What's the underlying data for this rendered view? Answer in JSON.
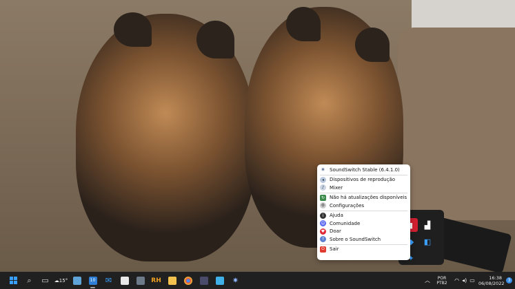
{
  "menu": {
    "title": "SoundSwitch Stable (6.4.1.0)",
    "items": [
      {
        "label": "Dispositivos de reprodução",
        "icon": "speaker-icon"
      },
      {
        "label": "Mixer",
        "icon": "mixer-icon"
      },
      {
        "label": "Não há atualizações disponíveis",
        "icon": "update-icon"
      },
      {
        "label": "Configurações",
        "icon": "settings-icon"
      },
      {
        "label": "Ajuda",
        "icon": "help-icon"
      },
      {
        "label": "Comunidade",
        "icon": "community-icon"
      },
      {
        "label": "Doar",
        "icon": "donate-icon"
      },
      {
        "label": "Sobre o SoundSwitch",
        "icon": "about-icon"
      },
      {
        "label": "Sair",
        "icon": "exit-icon"
      }
    ]
  },
  "taskbar": {
    "weather_temp": "15°",
    "mail_badge": "10",
    "app_label": "RH",
    "language": "POR",
    "keyboard": "PTB2",
    "time": "16:38",
    "date": "06/08/2022",
    "notification_count": "3"
  },
  "colors": {
    "taskbar_bg": "#202020",
    "accent": "#3aa0ff",
    "menu_bg": "#ffffff"
  }
}
